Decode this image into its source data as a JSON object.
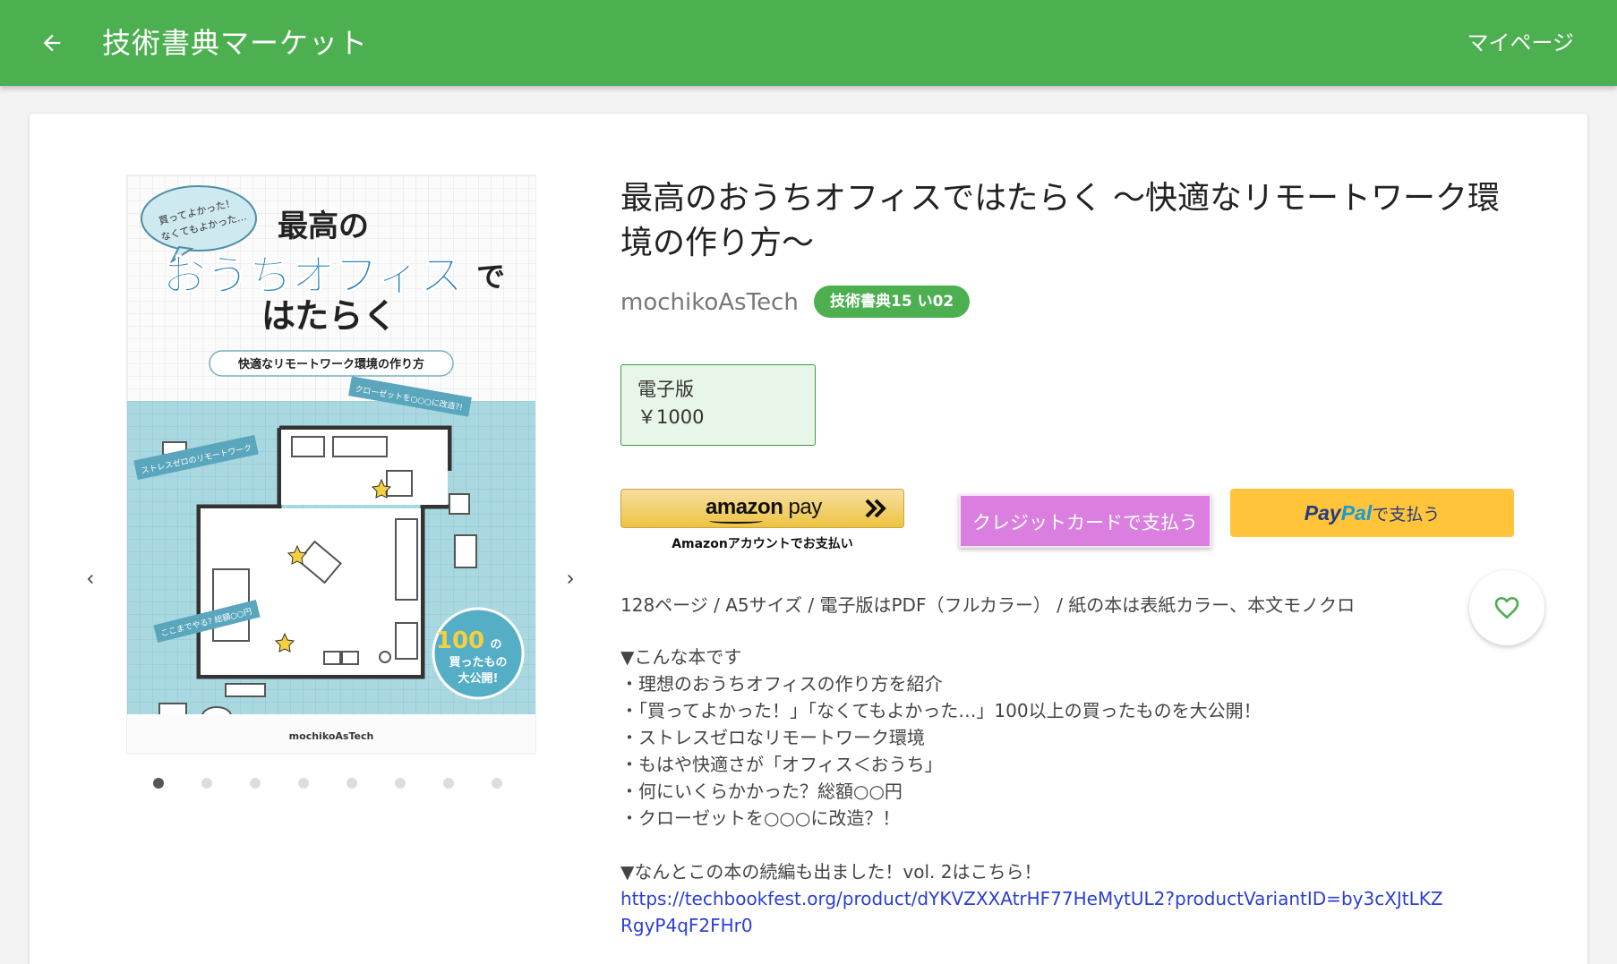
{
  "appbar": {
    "title": "技術書典マーケット",
    "mypage_label": "マイページ"
  },
  "colors": {
    "primary": "#4caf50",
    "variant_bg": "#e8f5e9",
    "credit": "#da7fe0",
    "paypal": "#ffc439",
    "amazon": "#eec342",
    "link": "#2a3fd1",
    "heart": "#4caf50"
  },
  "icons": {
    "back": "arrow-left",
    "prev": "chevron-left",
    "next": "chevron-right",
    "favorite": "heart-outline"
  },
  "cover": {
    "bubble_line1": "買ってよかった！",
    "bubble_line2": "なくてもよかった…",
    "title_line1": "最高の",
    "title_line2": "おうちオフィス",
    "title_line2_suffix": "で",
    "title_line3": "はたらく",
    "subtitle": "快適なリモートワーク環境の作り方",
    "banner_closet": "クローゼットを○○○に改造?!",
    "banner_stress": "ストレスゼロのリモートワーク",
    "banner_cost": "ここまでやる? 総額○○円",
    "badge_num": "100",
    "badge_no": "の",
    "badge_line2": "買ったもの",
    "badge_line3": "大公開!",
    "author": "mochikoAsTech"
  },
  "carousel": {
    "dot_count": 8,
    "active_index": 0
  },
  "product": {
    "title": "最高のおうちオフィスではたらく ～快適なリモートワーク環境の作り方～",
    "author": "mochikoAsTech",
    "event_badge": "技術書典15 い02",
    "variant_name": "電子版",
    "variant_price": "￥1000",
    "specs": "128ページ / A5サイズ / 電子版はPDF（フルカラー） / 紙の本は表紙カラー、本文モノクロ"
  },
  "payment": {
    "amazon_logo_main": "amazon",
    "amazon_logo_pay": " pay",
    "amazon_caption": "Amazonアカウントでお支払い",
    "credit_label": "クレジットカードで支払う",
    "paypal_pay": "Pay",
    "paypal_pal": "Pal",
    "paypal_suffix": "で支払う"
  },
  "description": {
    "lines": [
      "▼こんな本です",
      "・理想のおうちオフィスの作り方を紹介",
      "・「買ってよかった！」「なくてもよかった…」100以上の買ったものを大公開！",
      "・ストレスゼロなリモートワーク環境",
      "・もはや快適さが「オフィス＜おうち」",
      "・何にいくらかかった？総額○○円",
      "・クローゼットを○○○に改造？！",
      "",
      "▼なんとこの本の続編も出ました！vol. 2はこちら！"
    ],
    "link": "https://techbookfest.org/product/dYKVZXXAtrHF77HeMytUL2?productVariantID=by3cXJtLKZRgyP4qF2FHr0"
  }
}
